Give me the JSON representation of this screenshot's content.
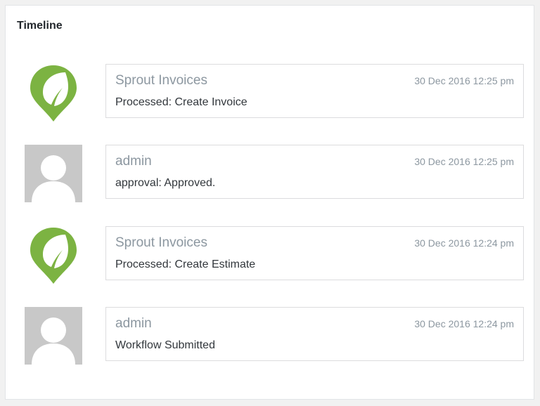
{
  "panel": {
    "title": "Timeline"
  },
  "timeline": [
    {
      "avatar": "sprout-leaf-logo",
      "author": "Sprout Invoices",
      "time": "30 Dec 2016 12:25 pm",
      "message": "Processed: Create Invoice"
    },
    {
      "avatar": "default-user-avatar",
      "author": "admin",
      "time": "30 Dec 2016 12:25 pm",
      "message": "approval: Approved."
    },
    {
      "avatar": "sprout-leaf-logo",
      "author": "Sprout Invoices",
      "time": "30 Dec 2016 12:24 pm",
      "message": "Processed: Create Estimate"
    },
    {
      "avatar": "default-user-avatar",
      "author": "admin",
      "time": "30 Dec 2016 12:24 pm",
      "message": "Workflow Submitted"
    }
  ],
  "colors": {
    "sprout_green": "#7cb342",
    "avatar_gray": "#c8c8c8"
  }
}
